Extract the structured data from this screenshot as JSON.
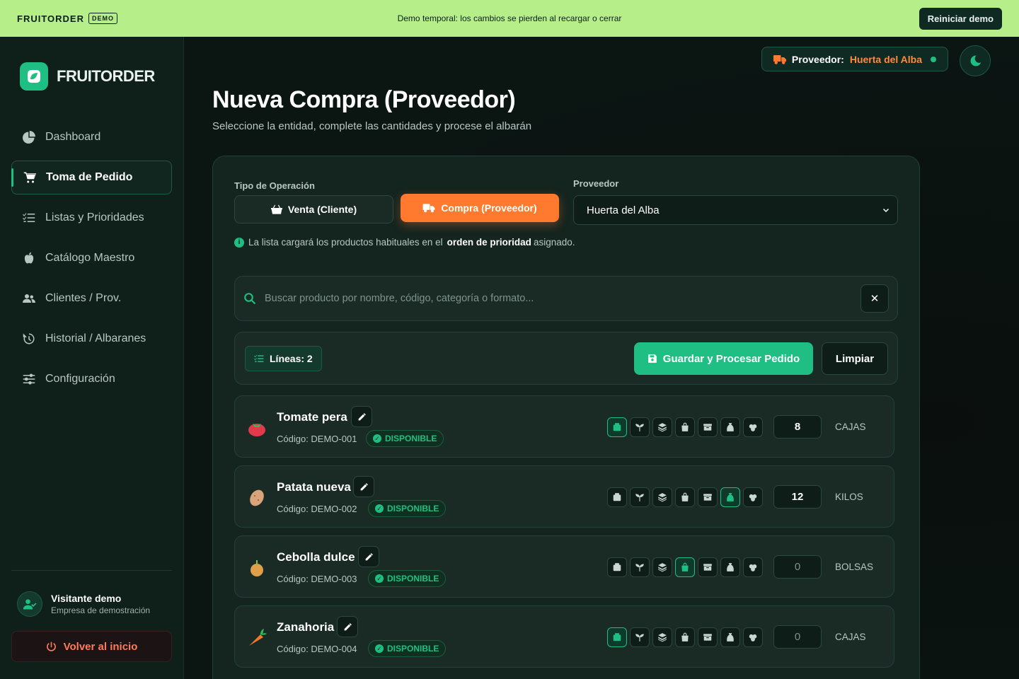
{
  "banner": {
    "brand": "FRUITORDER",
    "tag": "DEMO",
    "message": "Demo temporal: los cambios se pierden al recargar o cerrar",
    "reset_label": "Reiniciar demo"
  },
  "sidebar": {
    "logo_text": "FRUITORDER",
    "items": [
      {
        "label": "Dashboard",
        "icon": "pie-chart-icon",
        "active": false
      },
      {
        "label": "Toma de Pedido",
        "icon": "cart-icon",
        "active": true
      },
      {
        "label": "Listas y Prioridades",
        "icon": "list-check-icon",
        "active": false
      },
      {
        "label": "Catálogo Maestro",
        "icon": "apple-icon",
        "active": false
      },
      {
        "label": "Clientes / Prov.",
        "icon": "users-icon",
        "active": false
      },
      {
        "label": "Historial / Albaranes",
        "icon": "history-icon",
        "active": false
      },
      {
        "label": "Configuración",
        "icon": "sliders-icon",
        "active": false
      }
    ],
    "user": {
      "name": "Visitante demo",
      "company": "Empresa de demostración"
    },
    "back_label": "Volver al inicio"
  },
  "header": {
    "supplier_label": "Proveedor:",
    "supplier_value": "Huerta del Alba",
    "title": "Nueva Compra (Proveedor)",
    "subtitle": "Seleccione la entidad, complete las cantidades y procese el albarán"
  },
  "form": {
    "op_type_label": "Tipo de Operación",
    "op_sale_label": "Venta (Cliente)",
    "op_buy_label": "Compra (Proveedor)",
    "supplier_field_label": "Proveedor",
    "supplier_selected": "Huerta del Alba",
    "info_pre": "La lista cargará los productos habituales en el",
    "info_bold": "orden de prioridad",
    "info_post": "asignado.",
    "search_placeholder": "Buscar producto por nombre, código, categoría o formato...",
    "clear_search": "✕",
    "lines_label": "Líneas: 2",
    "save_label": "Guardar y Procesar Pedido",
    "clear_label": "Limpiar"
  },
  "products": [
    {
      "name": "Tomate pera",
      "code": "Código: DEMO-001",
      "status": "DISPONIBLE",
      "selected_format": 0,
      "qty": "8",
      "unit": "CAJAS",
      "icon": "tomato-icon",
      "color": "#e23a4a"
    },
    {
      "name": "Patata nueva",
      "code": "Código: DEMO-002",
      "status": "DISPONIBLE",
      "selected_format": 5,
      "qty": "12",
      "unit": "KILOS",
      "icon": "potato-icon",
      "color": "#d9a47a"
    },
    {
      "name": "Cebolla dulce",
      "code": "Código: DEMO-003",
      "status": "DISPONIBLE",
      "selected_format": 3,
      "qty": "0",
      "unit": "BOLSAS",
      "icon": "onion-icon",
      "color": "#e0a04a"
    },
    {
      "name": "Zanahoria",
      "code": "Código: DEMO-004",
      "status": "DISPONIBLE",
      "selected_format": 0,
      "qty": "0",
      "unit": "CAJAS",
      "icon": "carrot-icon",
      "color": "#f07a2a"
    }
  ],
  "formats": [
    "box-icon",
    "sprout-icon",
    "layers-icon",
    "bag-icon",
    "crate-icon",
    "sack-icon",
    "bunch-icon"
  ]
}
